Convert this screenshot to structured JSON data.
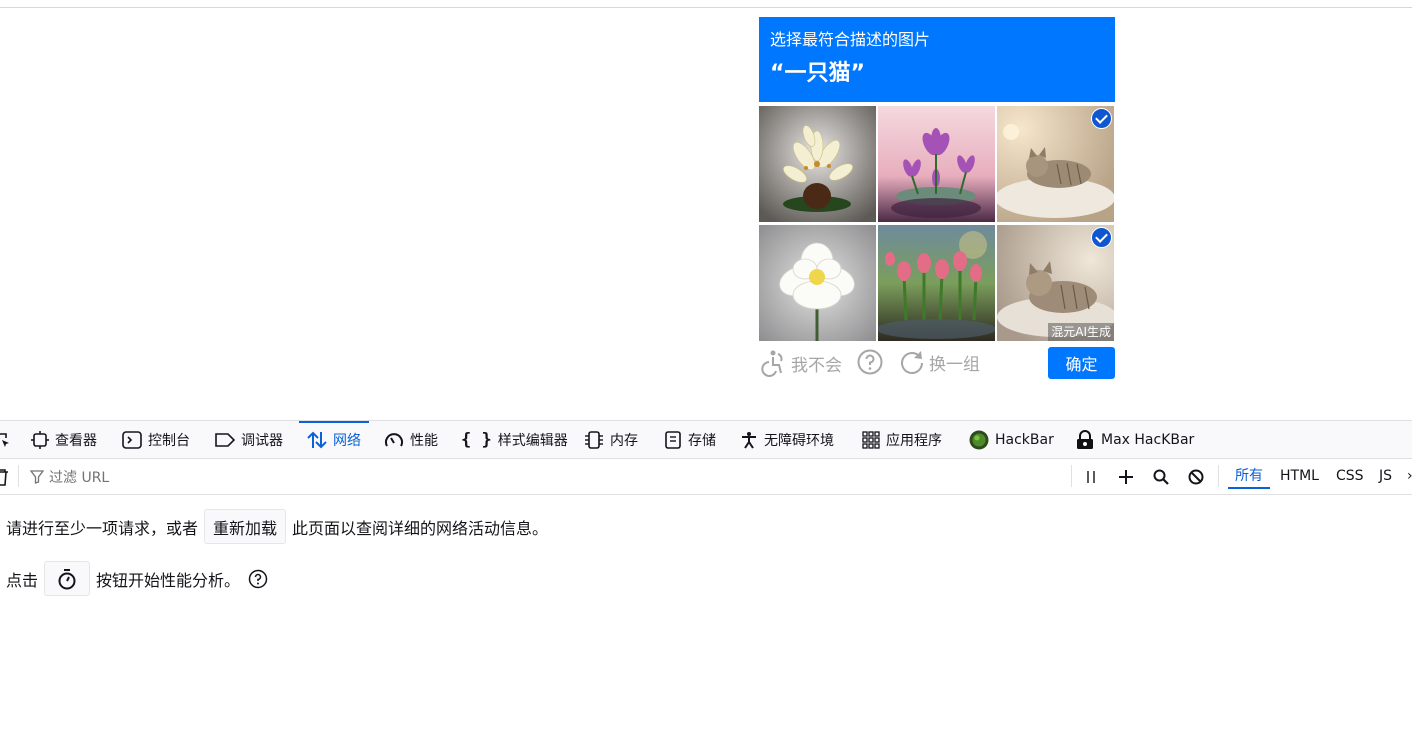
{
  "captcha": {
    "instruction": "选择最符合描述的图片",
    "target": "“一只猫”",
    "ai_badge": "混元AI生成",
    "tiles": [
      {
        "name": "lily",
        "selected": false
      },
      {
        "name": "lotus",
        "selected": false
      },
      {
        "name": "cat-1",
        "selected": true
      },
      {
        "name": "peony",
        "selected": false
      },
      {
        "name": "tulips",
        "selected": false
      },
      {
        "name": "cat-2",
        "selected": true
      }
    ],
    "dont_know_label": "我不会",
    "refresh_label": "换一组",
    "confirm_label": "确定",
    "accent": "#0077ff"
  },
  "devtools": {
    "tabs": [
      {
        "label": "查看器",
        "icon": "inspector-icon"
      },
      {
        "label": "控制台",
        "icon": "console-icon"
      },
      {
        "label": "调试器",
        "icon": "debugger-icon"
      },
      {
        "label": "网络",
        "icon": "network-icon",
        "active": true
      },
      {
        "label": "性能",
        "icon": "performance-icon"
      },
      {
        "label": "样式编辑器",
        "icon": "style-editor-icon"
      },
      {
        "label": "内存",
        "icon": "memory-icon"
      },
      {
        "label": "存储",
        "icon": "storage-icon"
      },
      {
        "label": "无障碍环境",
        "icon": "accessibility-icon"
      },
      {
        "label": "应用程序",
        "icon": "application-icon"
      },
      {
        "label": "HackBar",
        "icon": "hackbar-icon"
      },
      {
        "label": "Max HacKBar",
        "icon": "max-hackbar-icon"
      }
    ],
    "filter_placeholder": "过滤 URL",
    "type_filters": [
      {
        "label": "所有",
        "active": true
      },
      {
        "label": "HTML"
      },
      {
        "label": "CSS"
      },
      {
        "label": "JS"
      }
    ],
    "message_1_before": "请进行至少一项请求，或者",
    "reload_button": "重新加载",
    "message_1_after": "此页面以查阅详细的网络活动信息。",
    "message_2_before": "点击",
    "message_2_after": "按钮开始性能分析。",
    "active_color": "#0a61d9"
  }
}
